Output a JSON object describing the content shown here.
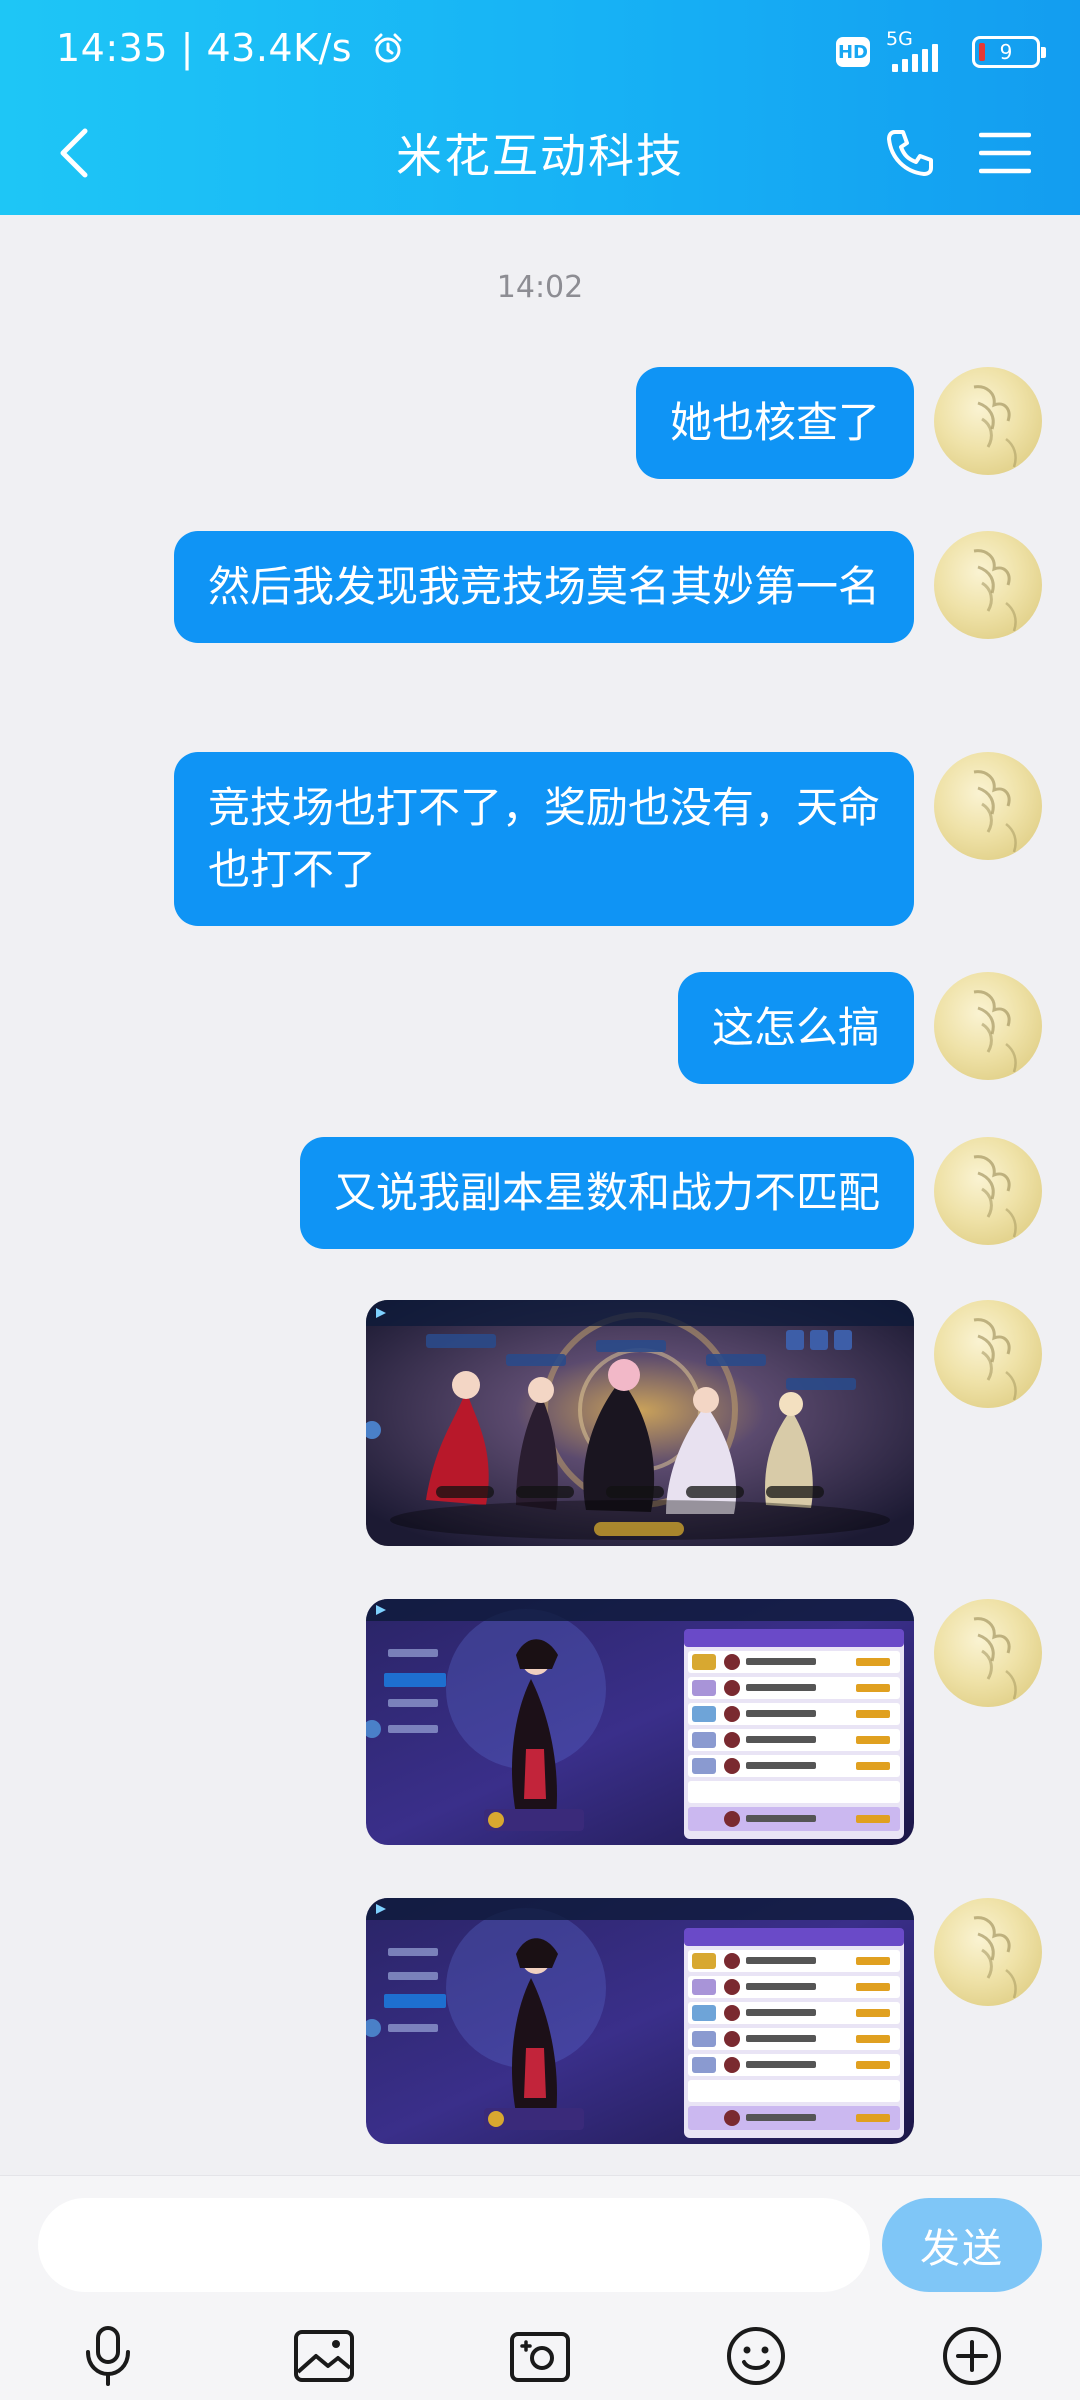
{
  "status_bar": {
    "time": "14:35 | 43.4K/s",
    "hd": "HD",
    "network": "5G",
    "battery": "9"
  },
  "header": {
    "title": "米花互动科技"
  },
  "messages": {
    "timestamp": "14:02",
    "items": [
      {
        "type": "text",
        "text": "她也核查了"
      },
      {
        "type": "text",
        "text": "然后我发现我竞技场莫名其妙第一名"
      },
      {
        "type": "text",
        "text": "竞技场也打不了，奖励也没有，天命也打不了"
      },
      {
        "type": "text",
        "text": "这怎么搞"
      },
      {
        "type": "text",
        "text": "又说我副本星数和战力不匹配"
      },
      {
        "type": "image",
        "icon": "game-arena-screenshot"
      },
      {
        "type": "image",
        "icon": "game-ranking-screenshot"
      },
      {
        "type": "image",
        "icon": "game-ranking-screenshot"
      }
    ]
  },
  "input": {
    "value": "",
    "placeholder": "",
    "send_label": "发送"
  },
  "colors": {
    "header_start": "#1ec6f6",
    "header_end": "#139df0",
    "bubble": "#0f94f5",
    "background": "#f0f0f3",
    "send_button": "#7fc6f7"
  }
}
